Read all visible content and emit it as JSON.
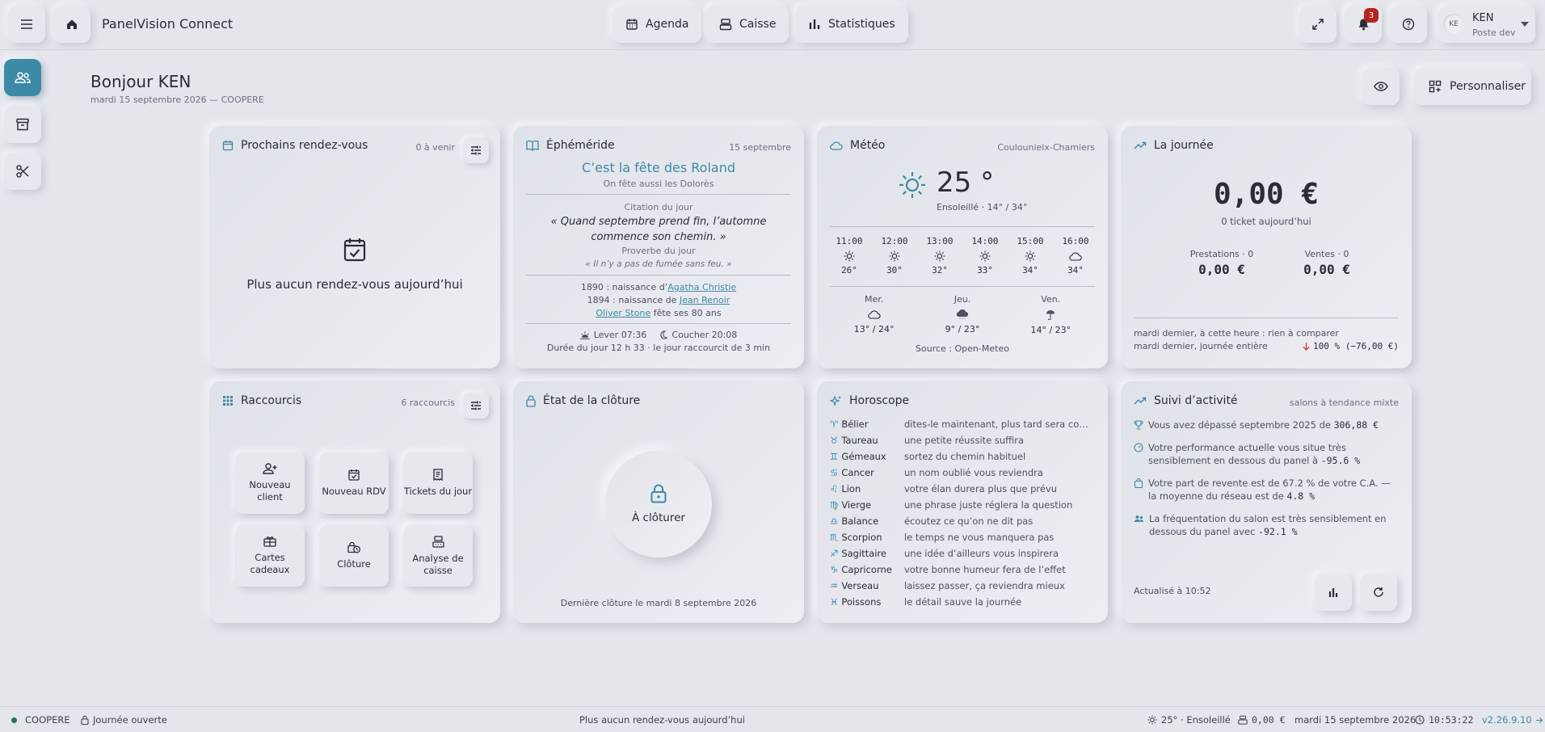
{
  "app": {
    "title": "PanelVision Connect"
  },
  "nav": [
    {
      "label": "Agenda",
      "icon": "calendar-icon"
    },
    {
      "label": "Caisse",
      "icon": "cash-register-icon"
    },
    {
      "label": "Statistiques",
      "icon": "bar-chart-icon"
    }
  ],
  "header_actions": {
    "notifications_count": "3"
  },
  "user": {
    "initials": "KE",
    "name": "KEN",
    "role": "Poste dev"
  },
  "greeting": {
    "title": "Bonjour KEN",
    "subtitle": "mardi 15 septembre 2026 — COOPERE"
  },
  "personalize_label": "Personnaliser",
  "appointments": {
    "title": "Prochains rendez-vous",
    "count": "0 à venir",
    "empty": "Plus aucun rendez-vous aujourd’hui"
  },
  "ephemeris": {
    "title": "Éphéméride",
    "date": "15 septembre",
    "feast": "C’est la fête des Roland",
    "also": "On fête aussi les Dolorès",
    "quote_label": "Citation du jour",
    "quote": "« Quand septembre prend fin, l’automne commence son chemin. »",
    "proverb_label": "Proverbe du jour",
    "proverb": "« Il n’y a pas de fumée sans feu. »",
    "birth1_prefix": "1890 : naissance d’",
    "birth1_name": "Agatha Christie",
    "birth2_prefix": "1894 : naissance de ",
    "birth2_name": "Jean Renoir",
    "birthday_name": "Oliver Stone",
    "birthday_suffix": " fête ses 80 ans",
    "sunrise": "Lever 07:36",
    "sunset": "Coucher 20:08",
    "daylength": "Durée du jour 12 h 33 · le jour raccourcit de 3 min"
  },
  "weather": {
    "title": "Météo",
    "location": "Coulounieix-Chamiers",
    "temp": "25 °",
    "summary": "Ensoleillé · 14° / 34°",
    "hours": [
      {
        "time": "11:00",
        "icon": "sun-icon",
        "temp": "26°"
      },
      {
        "time": "12:00",
        "icon": "sun-icon",
        "temp": "30°"
      },
      {
        "time": "13:00",
        "icon": "sun-icon",
        "temp": "32°"
      },
      {
        "time": "14:00",
        "icon": "sun-icon",
        "temp": "33°"
      },
      {
        "time": "15:00",
        "icon": "sun-icon",
        "temp": "34°"
      },
      {
        "time": "16:00",
        "icon": "cloud-icon",
        "temp": "34°"
      }
    ],
    "days": [
      {
        "day": "Mer.",
        "icon": "cloud-icon",
        "range": "13° / 24°"
      },
      {
        "day": "Jeu.",
        "icon": "rain-cloud-icon",
        "range": "9° / 23°"
      },
      {
        "day": "Ven.",
        "icon": "umbrella-icon",
        "range": "14° / 23°"
      }
    ],
    "source": "Source : Open-Meteo"
  },
  "day_summary": {
    "title": "La journée",
    "total": "0,00 €",
    "tickets": "0 ticket aujourd’hui",
    "services_label": "Prestations · 0",
    "services_value": "0,00 €",
    "sales_label": "Ventes · 0",
    "sales_value": "0,00 €",
    "compare1": "mardi dernier, à cette heure : rien à comparer",
    "compare2": "mardi dernier, journée entière",
    "compare2_value": "100 % (−76,00 €)",
    "down_color": "#d43a32"
  },
  "shortcuts": {
    "title": "Raccourcis",
    "count": "6 raccourcis",
    "items": [
      {
        "label": "Nouveau client",
        "icon": "add-person-icon"
      },
      {
        "label": "Nouveau RDV",
        "icon": "calendar-check-icon"
      },
      {
        "label": "Tickets du jour",
        "icon": "receipt-icon"
      },
      {
        "label": "Cartes cadeaux",
        "icon": "gift-card-icon"
      },
      {
        "label": "Clôture",
        "icon": "lock-clock-icon"
      },
      {
        "label": "Analyse de caisse",
        "icon": "register-analysis-icon"
      }
    ]
  },
  "closing": {
    "title": "État de la clôture",
    "status": "À clôturer",
    "last": "Dernière clôture le mardi 8 septembre 2026"
  },
  "horoscope": {
    "title": "Horoscope",
    "signs": [
      {
        "sign": "Bélier",
        "glyph": "♈",
        "text": "dites-le maintenant, plus tard sera compliqué"
      },
      {
        "sign": "Taureau",
        "glyph": "♉",
        "text": "une petite réussite suffira"
      },
      {
        "sign": "Gémeaux",
        "glyph": "♊",
        "text": "sortez du chemin habituel"
      },
      {
        "sign": "Cancer",
        "glyph": "♋",
        "text": "un nom oublié vous reviendra"
      },
      {
        "sign": "Lion",
        "glyph": "♌",
        "text": "votre élan durera plus que prévu"
      },
      {
        "sign": "Vierge",
        "glyph": "♍",
        "text": "une phrase juste réglera la question"
      },
      {
        "sign": "Balance",
        "glyph": "♎",
        "text": "écoutez ce qu’on ne dit pas"
      },
      {
        "sign": "Scorpion",
        "glyph": "♏",
        "text": "le temps ne vous manquera pas"
      },
      {
        "sign": "Sagittaire",
        "glyph": "♐",
        "text": "une idée d’ailleurs vous inspirera"
      },
      {
        "sign": "Capricorne",
        "glyph": "♑",
        "text": "votre bonne humeur fera de l’effet"
      },
      {
        "sign": "Verseau",
        "glyph": "♒",
        "text": "laissez passer, ça reviendra mieux"
      },
      {
        "sign": "Poissons",
        "glyph": "♓",
        "text": "le détail sauve la journée"
      }
    ]
  },
  "activity": {
    "title": "Suivi d’activité",
    "tag": "salons à tendance mixte",
    "items": [
      {
        "icon": "trophy-icon",
        "text": "Vous avez dépassé septembre 2025 de ",
        "value": "306,88 €",
        "after": ""
      },
      {
        "icon": "gauge-icon",
        "text": "Votre performance actuelle vous situe très sensiblement en dessous du panel à ",
        "value": "-95.6 %",
        "after": ""
      },
      {
        "icon": "bag-icon",
        "text": "Votre part de revente est de 67.2 % de votre C.A. — la moyenne du réseau est de ",
        "value": "4.8 %",
        "after": ""
      },
      {
        "icon": "people-icon",
        "text": "La fréquentation du salon est très sensiblement en dessous du panel avec ",
        "value": "-92.1 %",
        "after": ""
      }
    ],
    "updated": "Actualisé à 10:52"
  },
  "footer": {
    "salon": "COOPERE",
    "day_state": "Journée ouverte",
    "center": "Plus aucun rendez-vous aujourd’hui",
    "weather": "25° · Ensoleillé",
    "till": "0,00 €",
    "date": "mardi 15 septembre 2026",
    "time": "10:53:22",
    "version": "v2.26.9.10",
    "status_color": "#1f7a4d",
    "accent": "#3d8aa6"
  }
}
